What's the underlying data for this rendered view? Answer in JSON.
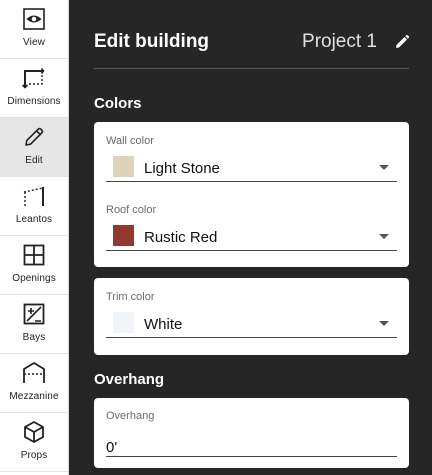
{
  "sidebar": {
    "items": [
      {
        "label": "View",
        "icon": "eye-icon"
      },
      {
        "label": "Dimensions",
        "icon": "dimensions-icon"
      },
      {
        "label": "Edit",
        "icon": "pencil-icon",
        "active": true
      },
      {
        "label": "Leantos",
        "icon": "leanto-icon"
      },
      {
        "label": "Openings",
        "icon": "window-icon"
      },
      {
        "label": "Bays",
        "icon": "bays-icon"
      },
      {
        "label": "Mezzanine",
        "icon": "mezzanine-icon"
      },
      {
        "label": "Props",
        "icon": "cube-icon"
      }
    ]
  },
  "header": {
    "title": "Edit building",
    "project_name": "Project 1",
    "edit_icon": "pencil-icon"
  },
  "colors_section": {
    "title": "Colors",
    "wall": {
      "label": "Wall color",
      "value": "Light Stone",
      "swatch": "#ddd3b8"
    },
    "roof": {
      "label": "Roof color",
      "value": "Rustic Red",
      "swatch": "#923a2f"
    },
    "trim": {
      "label": "Trim color",
      "value": "White",
      "swatch": "#eef4f9"
    }
  },
  "overhang_section": {
    "title": "Overhang",
    "field": {
      "label": "Overhang",
      "value": "0'"
    }
  }
}
